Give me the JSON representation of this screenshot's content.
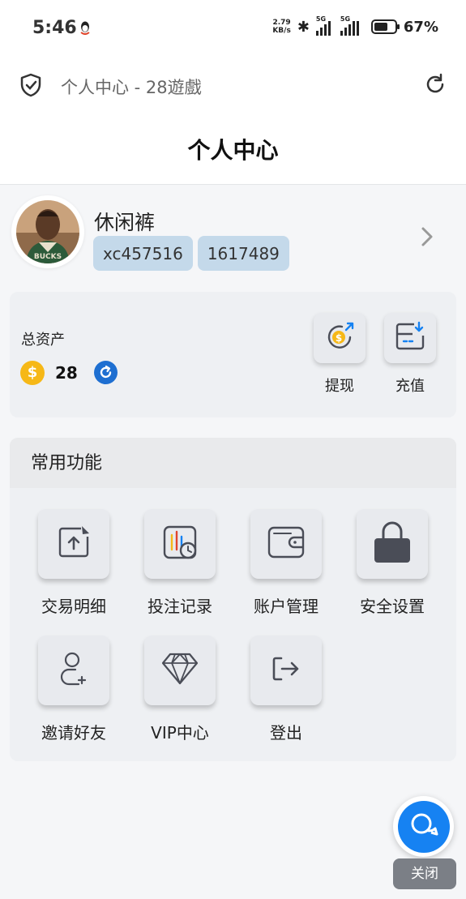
{
  "status_bar": {
    "time": "5:46",
    "net_speed_value": "2.79",
    "net_speed_unit": "KB/s",
    "sim1": "5G",
    "sim2": "5G",
    "battery_percent": "67%",
    "battery_level": 0.67
  },
  "browser": {
    "page_title": "个人中心 - 28遊戲"
  },
  "header": {
    "title": "个人中心"
  },
  "profile": {
    "username": "休闲裤",
    "account_id": "xc457516",
    "user_number": "1617489"
  },
  "assets": {
    "label": "总资产",
    "value": "28",
    "coin_symbol": "$",
    "withdraw_label": "提现",
    "deposit_label": "充值"
  },
  "functions": {
    "title": "常用功能",
    "items": [
      {
        "label": "交易明细",
        "icon": "upload-file-icon"
      },
      {
        "label": "投注记录",
        "icon": "bet-record-icon"
      },
      {
        "label": "账户管理",
        "icon": "wallet-icon"
      },
      {
        "label": "安全设置",
        "icon": "lock-icon"
      },
      {
        "label": "邀请好友",
        "icon": "add-user-icon"
      },
      {
        "label": "VIP中心",
        "icon": "diamond-icon"
      },
      {
        "label": "登出",
        "icon": "logout-icon"
      }
    ]
  },
  "floating": {
    "close_label": "关闭"
  },
  "colors": {
    "accent_blue": "#1682f2",
    "coin_gold": "#f6b817",
    "tag_bg": "#c4d9ea",
    "card_bg": "#eef0f3"
  }
}
